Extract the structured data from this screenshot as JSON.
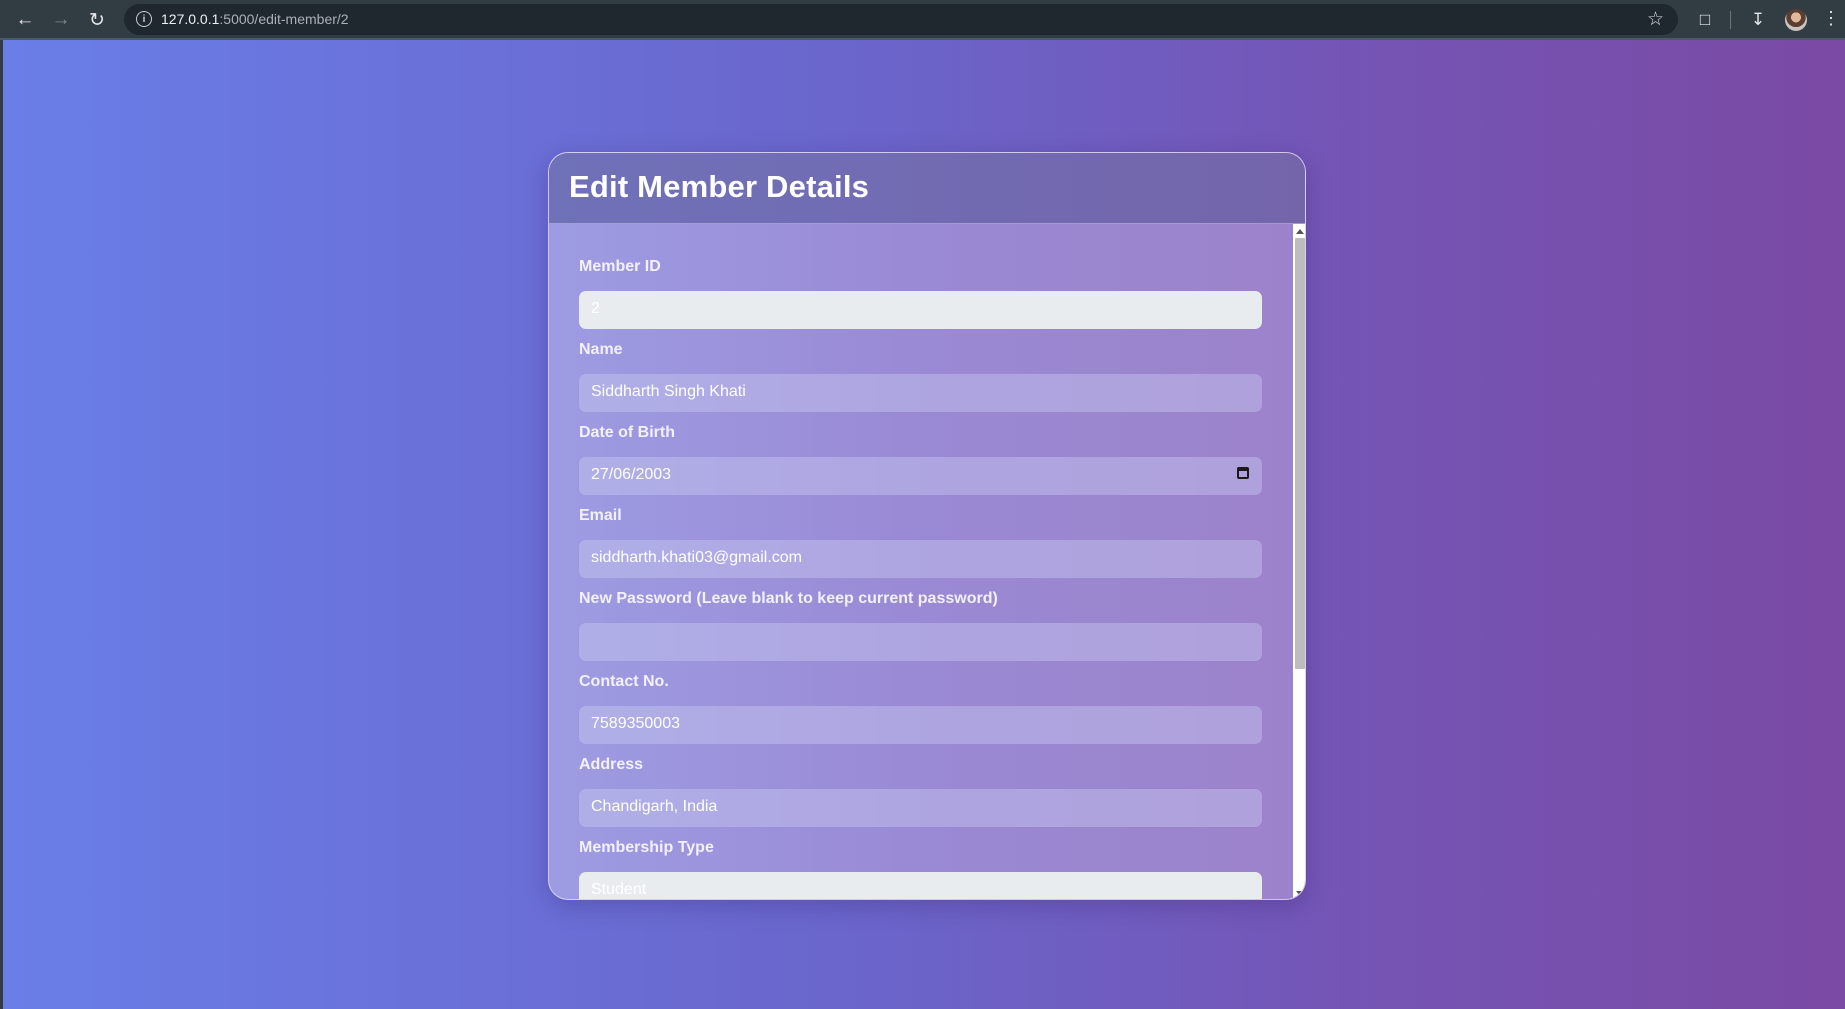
{
  "browser": {
    "url_host": "127.0.0.1",
    "url_path": ":5000/edit-member/2"
  },
  "form": {
    "title": "Edit Member Details",
    "fields": [
      {
        "label": "Member ID",
        "value": "2",
        "readonly": true
      },
      {
        "label": "Name",
        "value": "Siddharth Singh Khati",
        "readonly": false
      },
      {
        "label": "Date of Birth",
        "value": "27/06/2003",
        "readonly": false,
        "type": "date"
      },
      {
        "label": "Email",
        "value": "siddharth.khati03@gmail.com",
        "readonly": false
      },
      {
        "label": "New Password (Leave blank to keep current password)",
        "value": "",
        "readonly": false
      },
      {
        "label": "Contact No.",
        "value": "7589350003",
        "readonly": false
      },
      {
        "label": "Address",
        "value": "Chandigarh, India",
        "readonly": false
      },
      {
        "label": "Membership Type",
        "value": "Student",
        "readonly": true
      }
    ]
  },
  "colors": {
    "chrome": "#323c43",
    "gradient_start": "#6a7ee8",
    "gradient_end": "#7a4aa4",
    "readonly_input": "#e8ecee"
  }
}
